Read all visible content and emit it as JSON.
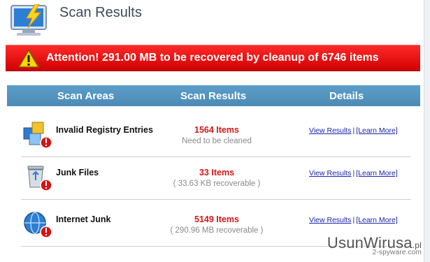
{
  "header": {
    "title": "Scan Results",
    "logo_icon": "monitor-lightning-icon"
  },
  "alert": {
    "message": "Attention! 291.00 MB to be recovered by cleanup of 6746 items",
    "icon": "warning-triangle-icon"
  },
  "table": {
    "columns": [
      "Scan Areas",
      "Scan Results",
      "Details"
    ],
    "rows": [
      {
        "name": "Invalid Registry Entries",
        "count": "1564 Items",
        "sub": "Need to be cleaned",
        "icon": "registry-cubes-icon",
        "view": "View Results",
        "learn": "[Learn More]"
      },
      {
        "name": "Junk Files",
        "count": "33 Items",
        "sub": "( 33.63 KB recoverable )",
        "icon": "recycle-bin-icon",
        "view": "View Results",
        "learn": "[Learn More]"
      },
      {
        "name": "Internet Junk",
        "count": "5149 Items",
        "sub": "( 290.96 MB recoverable )",
        "icon": "internet-globe-icon",
        "view": "View Results",
        "learn": "[Learn More]"
      }
    ]
  },
  "watermark": {
    "text": "UsunWirusa",
    "suffix": ".pl",
    "small": "2-spyware.com"
  },
  "colors": {
    "alert_red": "#e00000",
    "table_header_blue": "#5596c3",
    "count_red": "#d01818",
    "link_blue": "#1a24a8"
  }
}
